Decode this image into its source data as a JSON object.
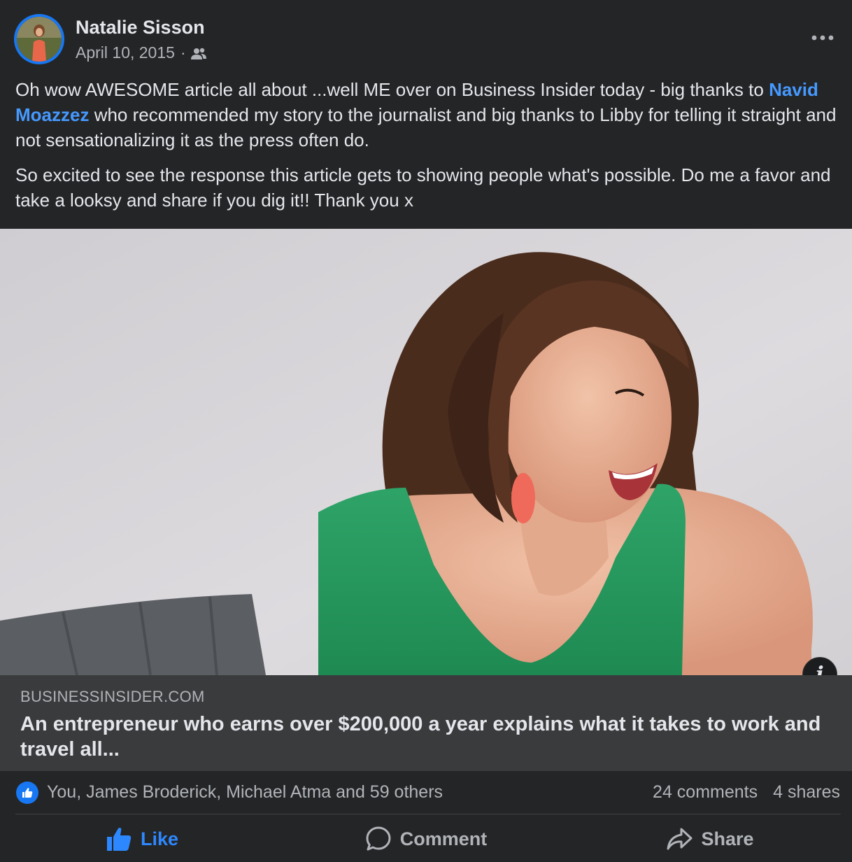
{
  "post": {
    "author": "Natalie Sisson",
    "date": "April 10, 2015",
    "separator": "·",
    "audience_icon": "friends-icon",
    "more_icon": "more-horizontal-icon",
    "text": {
      "p1_before": "Oh wow AWESOME article all about ...well ME over on Business Insider today - big thanks to ",
      "mention": "Navid Moazzez",
      "p1_after": " who recommended my story to the journalist and big thanks to Libby for telling it straight and not sensationalizing it as the press often do.",
      "p2": "So excited to see the response this article gets to showing people what's possible. Do me a favor and take a looksy and share if you dig it!! Thank you x"
    }
  },
  "link": {
    "domain": "BUSINESSINSIDER.COM",
    "title": "An entrepreneur who earns over $200,000 a year explains what it takes to work and travel all...",
    "info_icon": "info-icon",
    "info_label": "i"
  },
  "summary": {
    "reaction_icon": "like-reaction-icon",
    "reactors": "You, James Broderick, Michael Atma and 59 others",
    "comments": "24 comments",
    "shares": "4 shares"
  },
  "actions": {
    "like": "Like",
    "comment": "Comment",
    "share": "Share"
  },
  "colors": {
    "background": "#242526",
    "link_caption_bg": "#3a3b3c",
    "accent_blue": "#1877f2",
    "mention_blue": "#4599ff",
    "primary_text": "#e4e6eb",
    "secondary_text": "#b0b3b8"
  }
}
